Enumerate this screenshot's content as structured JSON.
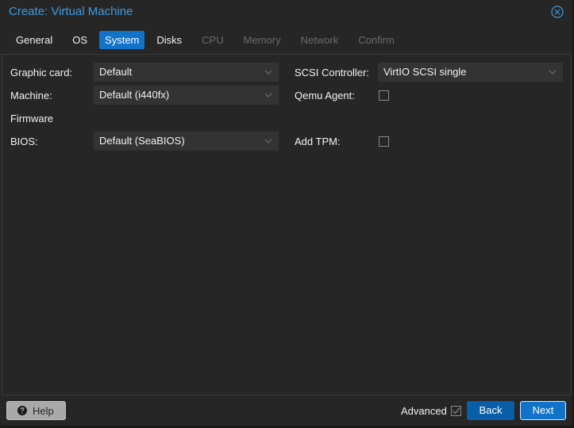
{
  "window": {
    "title": "Create: Virtual Machine",
    "close_icon": "close-circle-icon"
  },
  "tabs": [
    {
      "label": "General",
      "state": "normal"
    },
    {
      "label": "OS",
      "state": "normal"
    },
    {
      "label": "System",
      "state": "active"
    },
    {
      "label": "Disks",
      "state": "normal"
    },
    {
      "label": "CPU",
      "state": "disabled"
    },
    {
      "label": "Memory",
      "state": "disabled"
    },
    {
      "label": "Network",
      "state": "disabled"
    },
    {
      "label": "Confirm",
      "state": "disabled"
    }
  ],
  "form": {
    "graphic_card": {
      "label": "Graphic card:",
      "value": "Default"
    },
    "machine": {
      "label": "Machine:",
      "value": "Default (i440fx)"
    },
    "firmware_heading": "Firmware",
    "bios": {
      "label": "BIOS:",
      "value": "Default (SeaBIOS)"
    },
    "scsi_controller": {
      "label": "SCSI Controller:",
      "value": "VirtIO SCSI single"
    },
    "qemu_agent": {
      "label": "Qemu Agent:",
      "checked": false
    },
    "add_tpm": {
      "label": "Add TPM:",
      "checked": false
    }
  },
  "footer": {
    "help_label": "Help",
    "help_icon": "question-circle-icon",
    "advanced_label": "Advanced",
    "advanced_checked": true,
    "back_label": "Back",
    "next_label": "Next"
  },
  "colors": {
    "accent": "#1073c9",
    "title": "#3d9ae0",
    "background": "#262626",
    "field": "#333333",
    "disabled_text": "#6b6b6b"
  }
}
